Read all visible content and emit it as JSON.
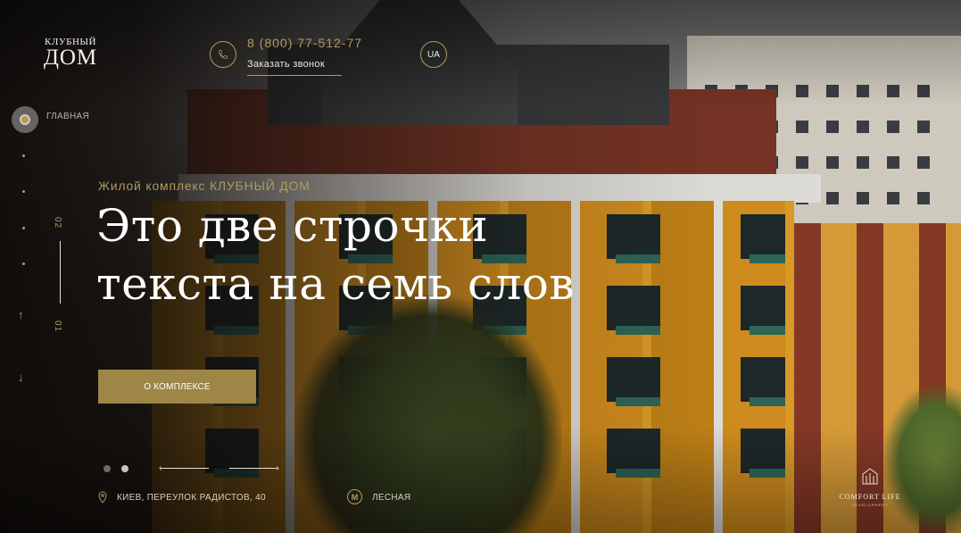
{
  "logo": {
    "top": "КЛУБНЫЙ",
    "bottom": "ДОМ"
  },
  "header": {
    "phone": "8 (800) 77-512-77",
    "callback_label": "Заказать звонок",
    "language": "UA"
  },
  "side_nav": {
    "active_label": "ГЛАВНАЯ",
    "slide_numbers": {
      "upper": "02",
      "lower": "01"
    }
  },
  "hero": {
    "eyebrow": "Жилой комплекс КЛУБНЫЙ ДОМ",
    "headline_line1": "Это две строчки",
    "headline_line2": "текста на семь слов",
    "cta_label": "О КОМПЛЕКСЕ"
  },
  "slider": {
    "total_dots": 2,
    "active_dot": 2
  },
  "footer": {
    "address": "КИЕВ, ПЕРЕУЛОК РАДИСТОВ, 40",
    "metro_icon_letter": "М",
    "metro": "ЛЕСНАЯ",
    "developer_logo": {
      "name": "COMFORT LIFE",
      "subtitle": "DEVELOPMENT"
    }
  },
  "colors": {
    "accent": "#b19a5f",
    "button": "#9e8647",
    "headline": "#ffffff"
  }
}
